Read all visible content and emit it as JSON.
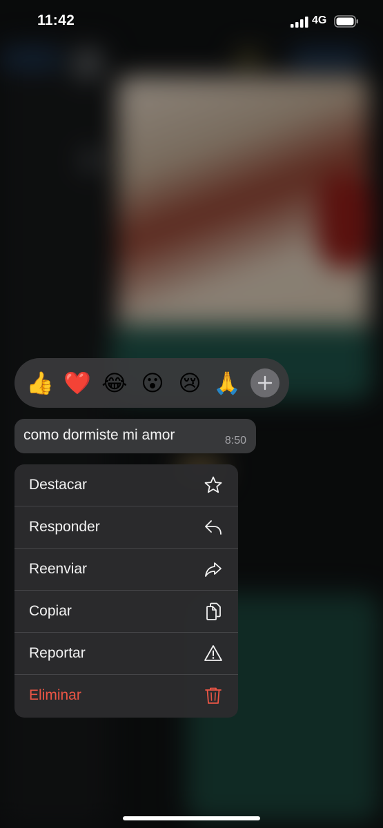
{
  "status_bar": {
    "time": "11:42",
    "network": "4G"
  },
  "reactions": {
    "emojis": [
      {
        "icon": "thumbs-up",
        "glyph": "👍"
      },
      {
        "icon": "red-heart",
        "glyph": "❤️"
      },
      {
        "icon": "tears-of-joy",
        "glyph": "😂"
      },
      {
        "icon": "surprised-face",
        "glyph": "😮"
      },
      {
        "icon": "crying-face",
        "glyph": "😢"
      },
      {
        "icon": "folded-hands",
        "glyph": "🙏"
      }
    ],
    "more_icon": "plus-icon"
  },
  "message": {
    "text": "como dormiste mi amor",
    "time": "8:50"
  },
  "menu": {
    "items": [
      {
        "label": "Destacar",
        "icon": "star-icon"
      },
      {
        "label": "Responder",
        "icon": "reply-icon"
      },
      {
        "label": "Reenviar",
        "icon": "forward-icon"
      },
      {
        "label": "Copiar",
        "icon": "copy-icon"
      },
      {
        "label": "Reportar",
        "icon": "warning-icon"
      },
      {
        "label": "Eliminar",
        "icon": "trash-icon",
        "destructive": true
      }
    ]
  },
  "colors": {
    "destructive": "#eb5545",
    "menu_background": "#2c2c2e",
    "bubble_background": "#37383a"
  }
}
